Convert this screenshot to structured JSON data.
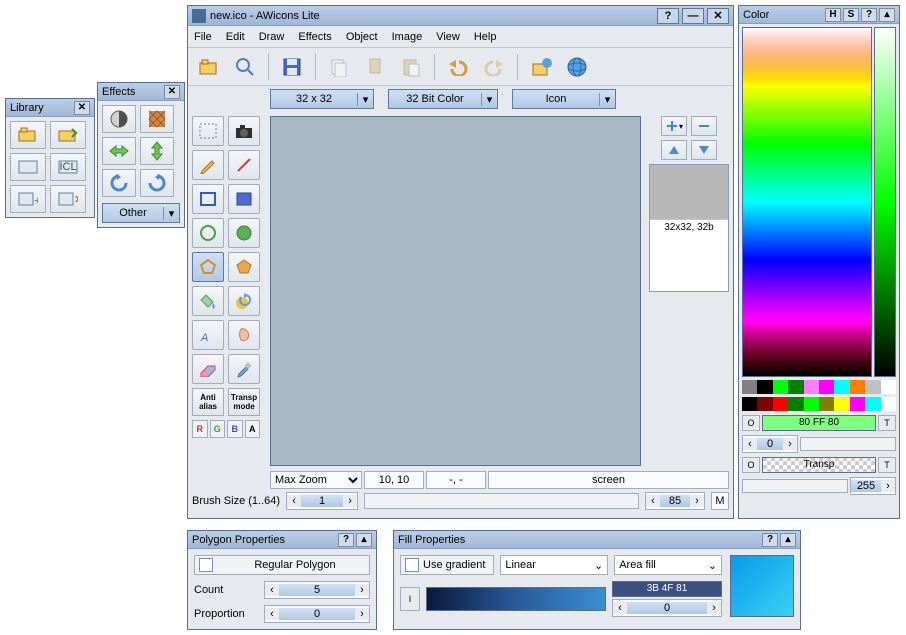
{
  "main": {
    "title": "new.ico - AWicons Lite",
    "menu": [
      "File",
      "Edit",
      "Draw",
      "Effects",
      "Object",
      "Image",
      "View",
      "Help"
    ],
    "size_select": "32 x 32",
    "depth_select": "32 Bit Color",
    "type_select": "Icon",
    "thumb_label": "32x32, 32b",
    "zoom_select": "Max Zoom",
    "coord": "10, 10",
    "sel": "-, -",
    "mode": "screen",
    "brush_label": "Brush Size (1..64)",
    "brush_value": "1",
    "opacity_value": "85",
    "opacity_suffix": "M",
    "tools": {
      "antialias": "Anti\nalias",
      "transp": "Transp\nmode",
      "r": "R",
      "g": "G",
      "b": "B",
      "a": "A"
    }
  },
  "library": {
    "title": "Library"
  },
  "effects": {
    "title": "Effects",
    "dropdown": "Other"
  },
  "color": {
    "title": "Color",
    "btns": [
      "H",
      "S"
    ],
    "swatches1": [
      "#808080",
      "#000000",
      "#00ff00",
      "#008000",
      "#ff80ff",
      "#ff00ff",
      "#00ffff",
      "#ff8000",
      "#c0c0c0",
      "#ffffff"
    ],
    "swatches2": [
      "#000000",
      "#800000",
      "#ff0000",
      "#008000",
      "#00ff00",
      "#808000",
      "#ffff00",
      "#ff00ff",
      "#00ffff",
      "#ffffff"
    ],
    "o1": "O",
    "t1": "T",
    "fg_hex": "80 FF 80",
    "fg_spinner": "0",
    "o2": "O",
    "t2": "T",
    "transp_label": "Transp",
    "alpha_val": "255"
  },
  "polygon": {
    "title": "Polygon Properties",
    "header": "Regular Polygon",
    "count_label": "Count",
    "count_val": "5",
    "prop_label": "Proportion",
    "prop_val": "0"
  },
  "fill": {
    "title": "Fill Properties",
    "use_gradient": "Use gradient",
    "gradient_type": "Linear",
    "fill_type": "Area fill",
    "i_label": "I",
    "color_hex": "3B 4F 81",
    "spinner_val": "0"
  }
}
